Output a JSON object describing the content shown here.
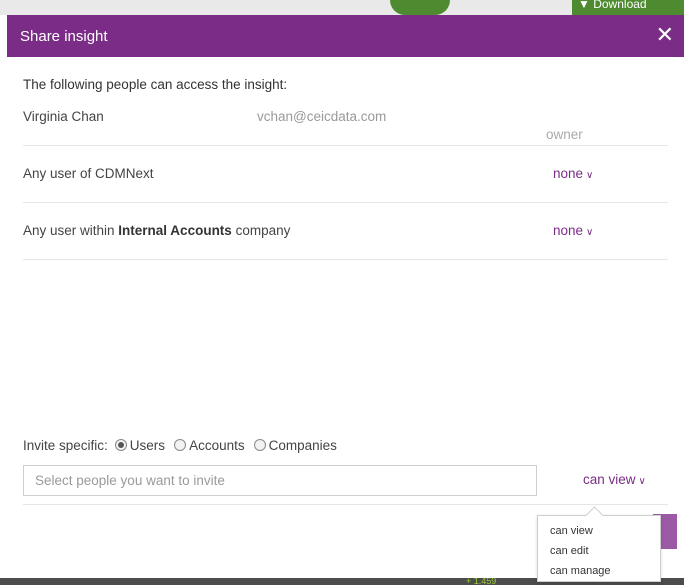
{
  "background": {
    "download_label": "Download",
    "zoom_text": "+ 1.459"
  },
  "dialog": {
    "title": "Share insight",
    "close_glyph": "✕",
    "intro": "The following people can access the insight:",
    "owner": {
      "name": "Virginia Chan",
      "email": "vchan@ceicdata.com",
      "role": "owner"
    },
    "rows": [
      {
        "label": "Any user of CDMNext",
        "value": "none"
      },
      {
        "label_prefix": "Any user within ",
        "label_bold": "Internal Accounts",
        "label_suffix": " company",
        "value": "none"
      }
    ],
    "invite": {
      "label": "Invite specific:",
      "options": [
        {
          "label": "Users",
          "selected": true
        },
        {
          "label": "Accounts",
          "selected": false
        },
        {
          "label": "Companies",
          "selected": false
        }
      ],
      "placeholder": "Select people you want to invite",
      "permission": "can view"
    },
    "permission_menu": [
      "can view",
      "can edit",
      "can manage"
    ]
  },
  "colors": {
    "accent": "#7b2c86",
    "header_text": "#ffffff"
  },
  "icons": {
    "chevron": "chevron-down-icon",
    "close": "close-icon"
  }
}
